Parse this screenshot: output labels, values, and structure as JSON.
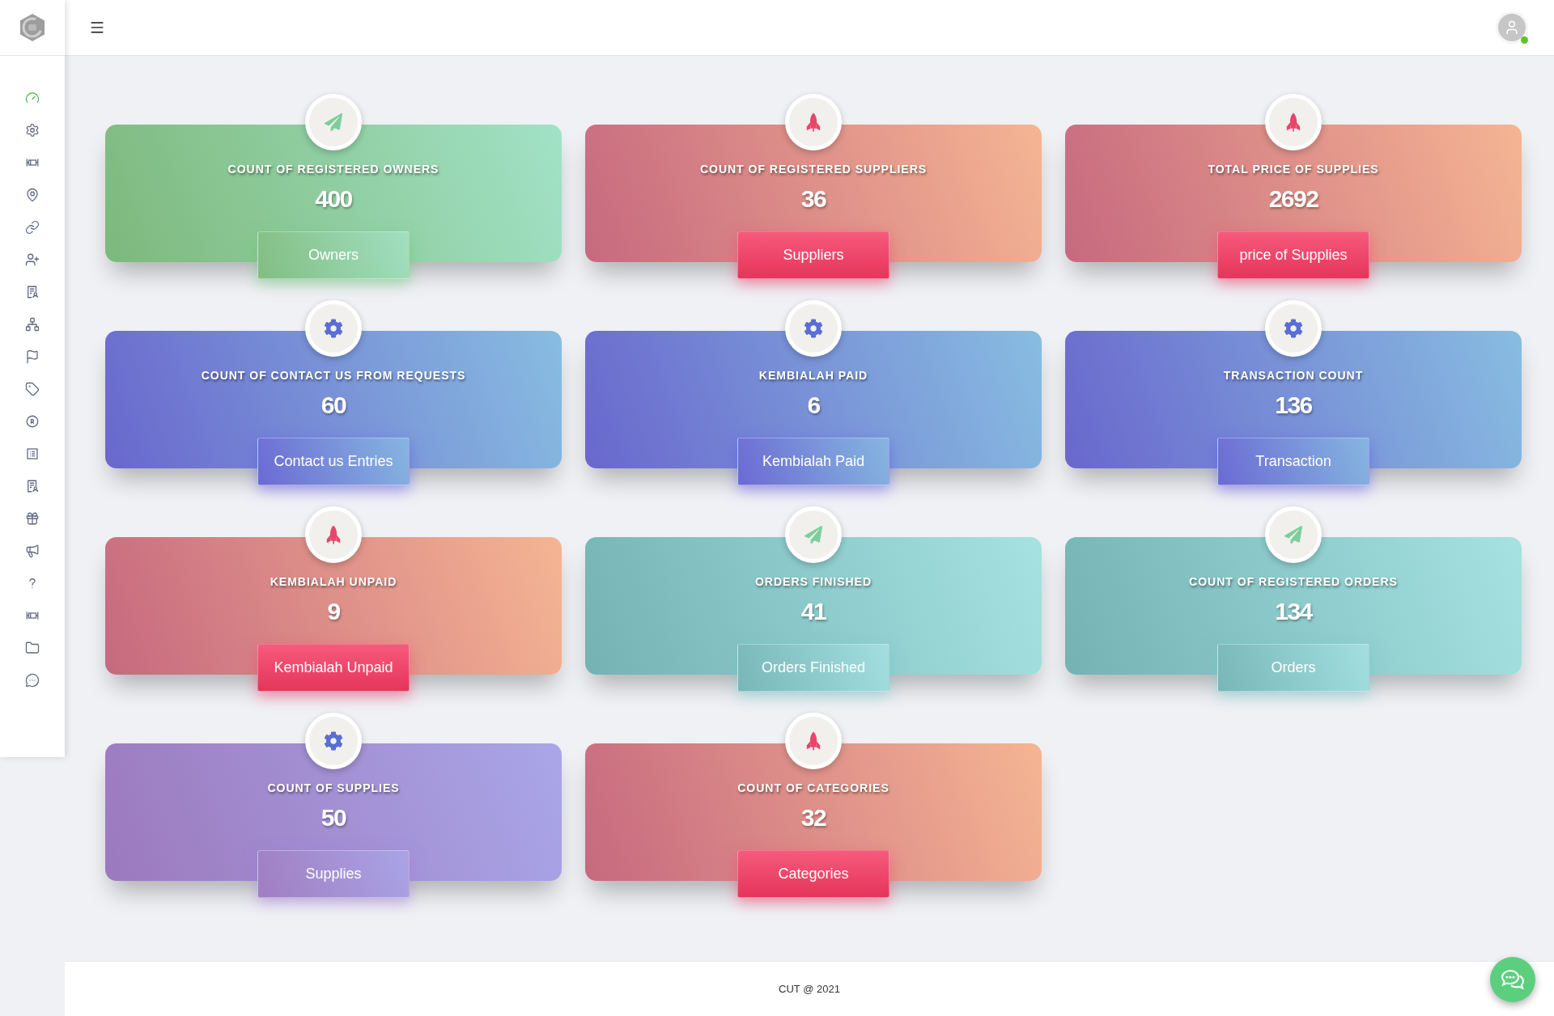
{
  "sidebar": {
    "items": [
      {
        "selected": true
      },
      {
        "selected": false
      },
      {
        "selected": false
      },
      {
        "selected": false
      },
      {
        "selected": false
      },
      {
        "selected": false
      },
      {
        "selected": false
      },
      {
        "selected": false
      },
      {
        "selected": false
      },
      {
        "selected": false
      },
      {
        "selected": false
      },
      {
        "selected": false
      },
      {
        "selected": false
      },
      {
        "selected": false
      },
      {
        "selected": false
      },
      {
        "selected": false
      },
      {
        "selected": false
      },
      {
        "selected": false
      },
      {
        "selected": false
      }
    ]
  },
  "header": {
    "user": {
      "online": true
    }
  },
  "cards": [
    {
      "kind": "green",
      "title": "COUNT OF REGISTERED OWNERS",
      "value": "400",
      "button": "Owners"
    },
    {
      "kind": "red",
      "title": "COUNT OF REGISTERED SUPPLIERS",
      "value": "36",
      "button": "Suppliers"
    },
    {
      "kind": "red",
      "title": "TOTAL PRICE OF SUPPLIES",
      "value": "2692",
      "button": "price of Supplies"
    },
    {
      "kind": "blue",
      "title": "COUNT OF CONTACT US FROM REQUESTS",
      "value": "60",
      "button": "Contact us Entries"
    },
    {
      "kind": "blue",
      "title": "KEMBIALAH PAID",
      "value": "6",
      "button": "Kembialah Paid"
    },
    {
      "kind": "blue",
      "title": "TRANSACTION COUNT",
      "value": "136",
      "button": "Transaction"
    },
    {
      "kind": "red",
      "title": "KEMBIALAH UNPAID",
      "value": "9",
      "button": "Kembialah Unpaid"
    },
    {
      "kind": "teal",
      "title": "ORDERS FINISHED",
      "value": "41",
      "button": "Orders Finished"
    },
    {
      "kind": "teal",
      "title": "COUNT OF REGISTERED ORDERS",
      "value": "134",
      "button": "Orders"
    },
    {
      "kind": "purple",
      "title": "COUNT OF SUPPLIES",
      "value": "50",
      "button": "Supplies"
    },
    {
      "kind": "red",
      "title": "COUNT OF CATEGORIES",
      "value": "32",
      "button": "Categories"
    }
  ],
  "footer": {
    "text": "CUT @ 2021"
  }
}
